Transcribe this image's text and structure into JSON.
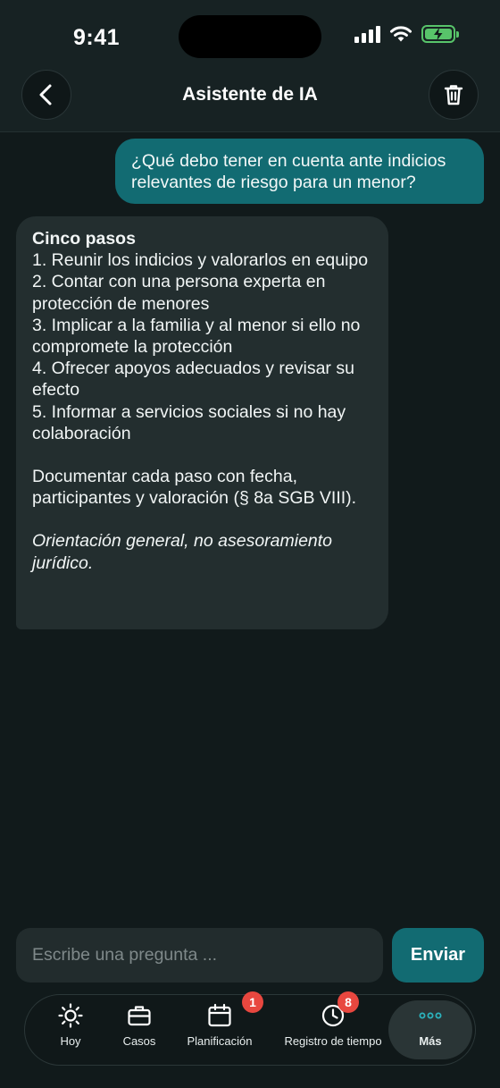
{
  "status_bar": {
    "time": "9:41"
  },
  "header": {
    "title": "Asistente de IA"
  },
  "messages": {
    "user": "¿Qué debo tener en cuenta ante indicios relevantes de riesgo para un menor?",
    "assistant": {
      "heading": "Cinco pasos",
      "steps": [
        "1. Reunir los indicios y valorarlos en equipo",
        "2. Contar con una persona experta en protección de menores",
        "3. Implicar a la familia y al menor si ello no compromete la protección",
        "4. Ofrecer apoyos adecuados y revisar su efecto",
        "5. Informar a servicios sociales si no hay colaboración"
      ],
      "note": "Documentar cada paso con fecha, participantes y valoración (§ 8a SGB VIII).",
      "disclaimer": "Orientación general, no asesoramiento jurídico."
    }
  },
  "composer": {
    "placeholder": "Escribe una pregunta ...",
    "send_label": "Enviar"
  },
  "tabbar": {
    "items": [
      {
        "label": "Hoy",
        "icon": "sun-icon"
      },
      {
        "label": "Casos",
        "icon": "briefcase-icon"
      },
      {
        "label": "Planificación",
        "icon": "calendar-icon",
        "badge": "1"
      },
      {
        "label": "Registro de tiempo",
        "icon": "clock-icon",
        "badge": "8"
      },
      {
        "label": "Más",
        "icon": "more-icon",
        "active": true
      }
    ]
  },
  "colors": {
    "accent": "#126b72",
    "badge": "#e8473f",
    "battery": "#58c46a",
    "more_dots": "#2bb3bd"
  }
}
